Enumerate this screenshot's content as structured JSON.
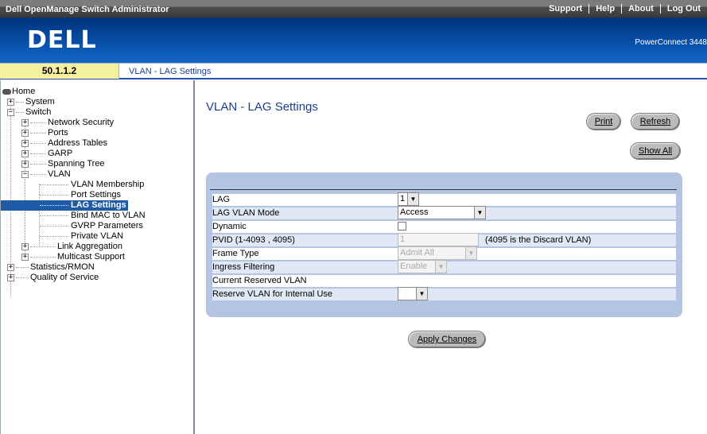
{
  "topbar": {
    "title": "Dell OpenManage Switch Administrator",
    "links": [
      "Support",
      "Help",
      "About",
      "Log Out"
    ]
  },
  "banner": {
    "logo": "DELL",
    "product": "PowerConnect 3448"
  },
  "crumbbar": {
    "ip": "50.1.1.2",
    "crumb": "VLAN - LAG Settings"
  },
  "tree": {
    "home": "Home",
    "system": "System",
    "switch": "Switch",
    "network_security": "Network Security",
    "ports": "Ports",
    "address_tables": "Address Tables",
    "garp": "GARP",
    "spanning_tree": "Spanning Tree",
    "vlan": "VLAN",
    "vlan_membership": "VLAN Membership",
    "port_settings": "Port Settings",
    "lag_settings": "LAG Settings",
    "bind_mac": "Bind MAC to VLAN",
    "gvrp": "GVRP Parameters",
    "private_vlan": "Private VLAN",
    "link_aggregation": "Link Aggregation",
    "multicast": "Multicast Support",
    "stats": "Statistics/RMON",
    "qos": "Quality of Service"
  },
  "page": {
    "title": "VLAN - LAG Settings",
    "print": "Print",
    "refresh": "Refresh",
    "show_all": "Show All",
    "apply": "Apply Changes"
  },
  "form": {
    "lag_label": "LAG",
    "lag_value": "1",
    "mode_label": "LAG VLAN Mode",
    "mode_value": "Access",
    "dynamic_label": "Dynamic",
    "pvid_label": "PVID (1-4093 , 4095)",
    "pvid_value": "1",
    "pvid_note": "(4095 is the Discard VLAN)",
    "frame_label": "Frame Type",
    "frame_value": "Admit All",
    "ingress_label": "Ingress Filtering",
    "ingress_value": "Enable",
    "reserved_label": "Current Reserved VLAN",
    "reserve_label": "Reserve VLAN for Internal Use",
    "reserve_value": ""
  }
}
